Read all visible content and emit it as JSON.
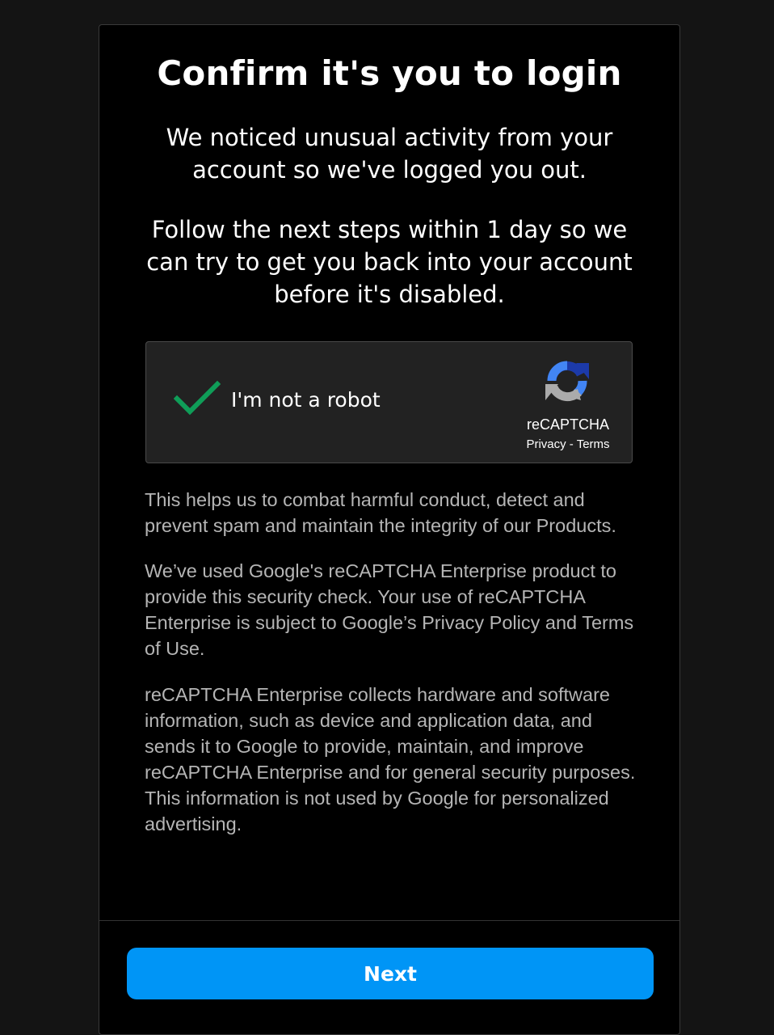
{
  "dialog": {
    "title": "Confirm it's you to login",
    "paragraph_1": "We noticed unusual activity from your account so we've logged you out.",
    "paragraph_2": "Follow the next steps within 1 day so we can try to get you back into your account before it's disabled."
  },
  "captcha": {
    "label": "I'm not a robot",
    "checked": true,
    "brand": "reCAPTCHA",
    "privacy_link": "Privacy",
    "separator": "-",
    "terms_link": "Terms",
    "check_color": "#0f9d58",
    "icons": [
      "checkmark-icon",
      "recaptcha-logo-icon"
    ]
  },
  "info": {
    "text_1": "This helps us to combat harmful conduct, detect and prevent spam and maintain the integrity of our Products.",
    "text_2": "We’ve used Google's reCAPTCHA Enterprise product to provide this security check. Your use of reCAPTCHA Enterprise is subject to Google’s Privacy Policy and Terms of Use.",
    "text_3": "reCAPTCHA Enterprise collects hardware and software information, such as device and application data, and sends it to Google to provide, maintain, and improve reCAPTCHA Enterprise and for general security purposes. This information is not used by Google for personalized advertising."
  },
  "footer": {
    "next_label": "Next",
    "button_color": "#0095f6"
  }
}
